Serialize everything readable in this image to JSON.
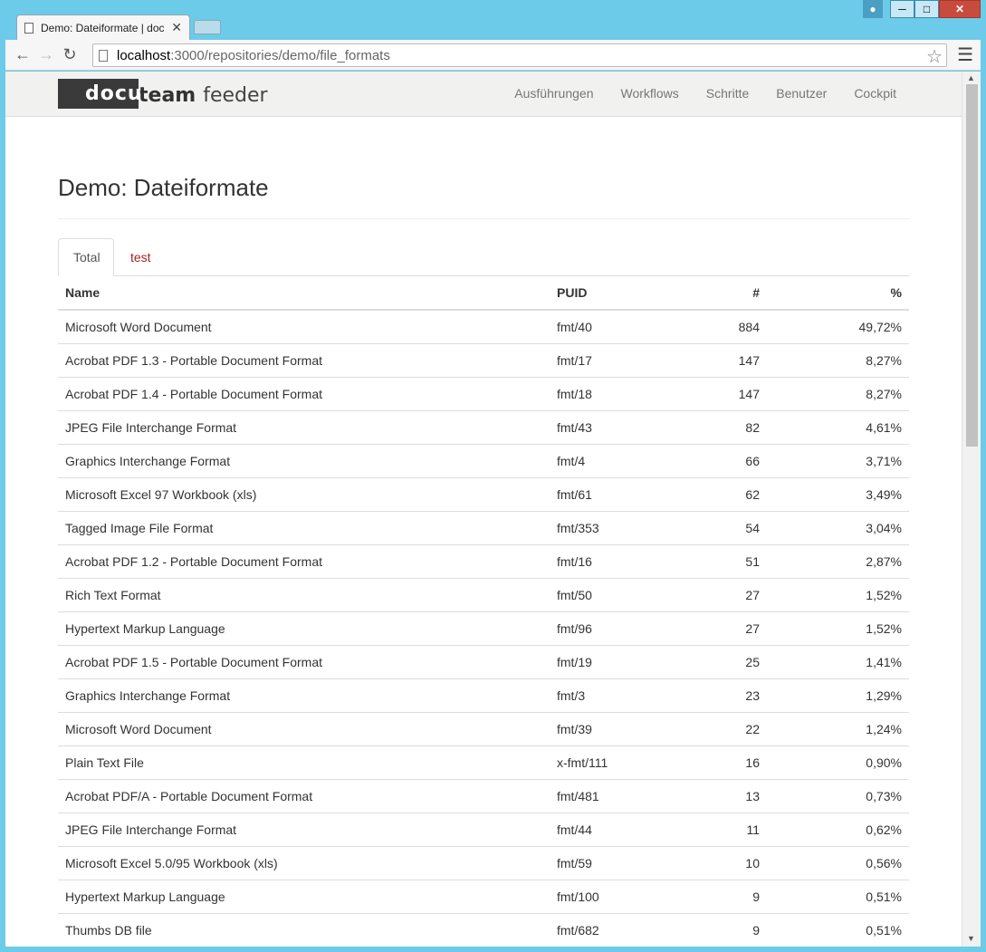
{
  "browser": {
    "tab_title": "Demo: Dateiformate | doc",
    "url_host": "localhost",
    "url_path": ":3000/repositories/demo/file_formats"
  },
  "navbar": {
    "logo_docu": "docu",
    "logo_team": "team",
    "logo_feeder": "feeder",
    "links": [
      "Ausführungen",
      "Workflows",
      "Schritte",
      "Benutzer",
      "Cockpit"
    ]
  },
  "page": {
    "title": "Demo: Dateiformate",
    "tabs": [
      "Total",
      "test"
    ]
  },
  "table": {
    "headers": [
      "Name",
      "PUID",
      "#",
      "%"
    ],
    "rows": [
      [
        "Microsoft Word Document",
        "fmt/40",
        "884",
        "49,72%"
      ],
      [
        "Acrobat PDF 1.3 - Portable Document Format",
        "fmt/17",
        "147",
        "8,27%"
      ],
      [
        "Acrobat PDF 1.4 - Portable Document Format",
        "fmt/18",
        "147",
        "8,27%"
      ],
      [
        "JPEG File Interchange Format",
        "fmt/43",
        "82",
        "4,61%"
      ],
      [
        "Graphics Interchange Format",
        "fmt/4",
        "66",
        "3,71%"
      ],
      [
        "Microsoft Excel 97 Workbook (xls)",
        "fmt/61",
        "62",
        "3,49%"
      ],
      [
        "Tagged Image File Format",
        "fmt/353",
        "54",
        "3,04%"
      ],
      [
        "Acrobat PDF 1.2 - Portable Document Format",
        "fmt/16",
        "51",
        "2,87%"
      ],
      [
        "Rich Text Format",
        "fmt/50",
        "27",
        "1,52%"
      ],
      [
        "Hypertext Markup Language",
        "fmt/96",
        "27",
        "1,52%"
      ],
      [
        "Acrobat PDF 1.5 - Portable Document Format",
        "fmt/19",
        "25",
        "1,41%"
      ],
      [
        "Graphics Interchange Format",
        "fmt/3",
        "23",
        "1,29%"
      ],
      [
        "Microsoft Word Document",
        "fmt/39",
        "22",
        "1,24%"
      ],
      [
        "Plain Text File",
        "x-fmt/111",
        "16",
        "0,90%"
      ],
      [
        "Acrobat PDF/A - Portable Document Format",
        "fmt/481",
        "13",
        "0,73%"
      ],
      [
        "JPEG File Interchange Format",
        "fmt/44",
        "11",
        "0,62%"
      ],
      [
        "Microsoft Excel 5.0/95 Workbook (xls)",
        "fmt/59",
        "10",
        "0,56%"
      ],
      [
        "Hypertext Markup Language",
        "fmt/100",
        "9",
        "0,51%"
      ],
      [
        "Thumbs DB file",
        "fmt/682",
        "9",
        "0,51%"
      ]
    ]
  }
}
